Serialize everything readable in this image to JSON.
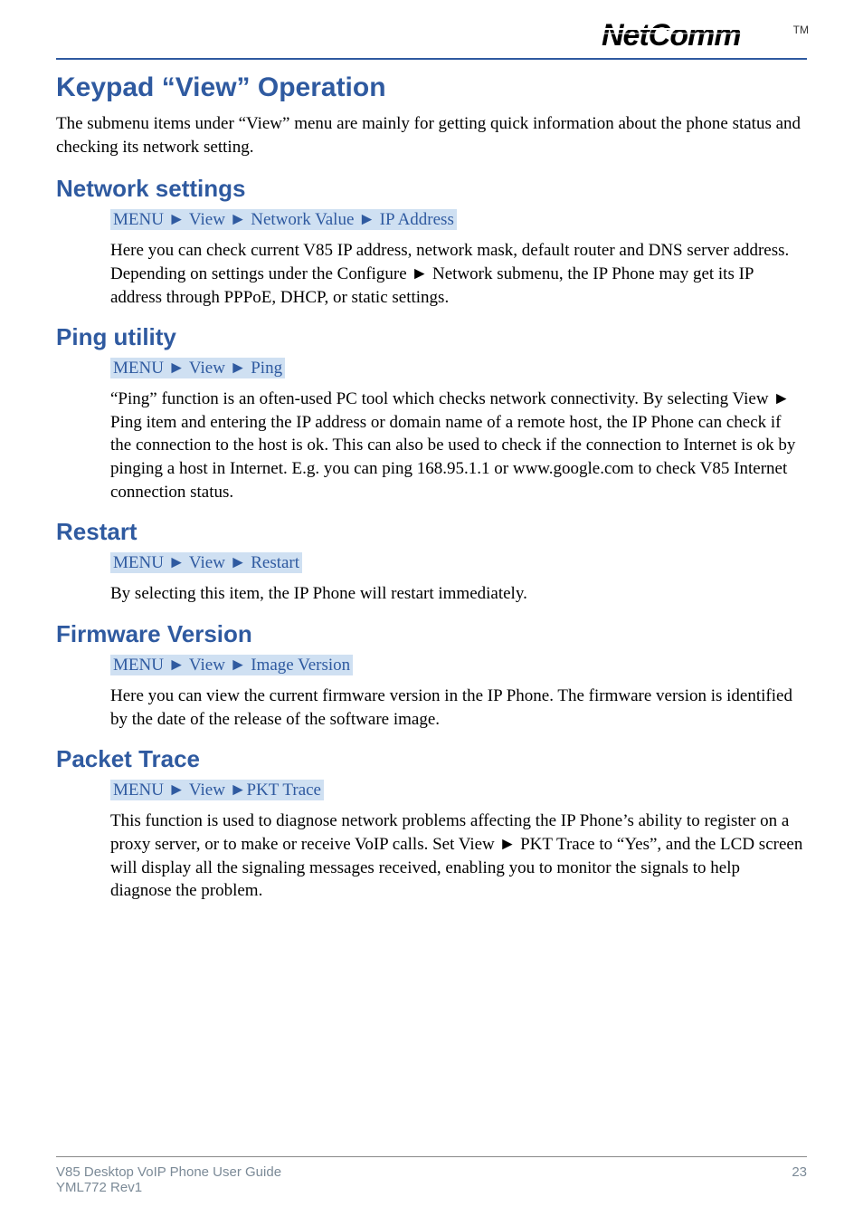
{
  "brand": {
    "name": "NetComm",
    "tm": "TM"
  },
  "title": "Keypad “View” Operation",
  "intro": "The submenu items under “View” menu are mainly for getting quick information about the phone status and checking its network setting.",
  "sections": {
    "network": {
      "heading": "Network settings",
      "path": "MENU ► View ► Network Value ► IP Address",
      "body": "Here you can check current V85 IP address, network mask, default router and DNS server address. Depending on settings under the Configure ► Network submenu, the IP Phone may get its IP address through PPPoE, DHCP, or static settings."
    },
    "ping": {
      "heading": "Ping utility",
      "path": "MENU ► View ► Ping",
      "body": "“Ping” function is an often-used PC tool which checks network connectivity. By selecting View ► Ping item and entering the IP address or domain name of a remote host, the IP Phone can check if the connection to the host is ok. This can also be used to check if the connection to Internet is ok by pinging a host in Internet. E.g. you can ping 168.95.1.1 or www.google.com to check V85 Internet connection status."
    },
    "restart": {
      "heading": "Restart",
      "path": "MENU ► View ► Restart",
      "body": "By selecting this item, the IP Phone will restart immediately."
    },
    "firmware": {
      "heading": "Firmware Version",
      "path": "MENU ► View ► Image Version",
      "body": "Here you can view the current firmware version in the IP Phone. The firmware version is identified by the date of the release of the software image."
    },
    "packettrace": {
      "heading": "Packet Trace",
      "path": "MENU ► View ►PKT Trace",
      "body": "This function is used to diagnose network problems affecting the IP Phone’s ability to register on a proxy server, or to make or receive VoIP calls.  Set  View ► PKT Trace to “Yes”, and the LCD screen will display all the signaling messages received, enabling you to monitor the signals to help diagnose the problem."
    }
  },
  "footer": {
    "line1": "V85 Desktop VoIP Phone User Guide",
    "line2": "YML772 Rev1",
    "page": "23"
  }
}
